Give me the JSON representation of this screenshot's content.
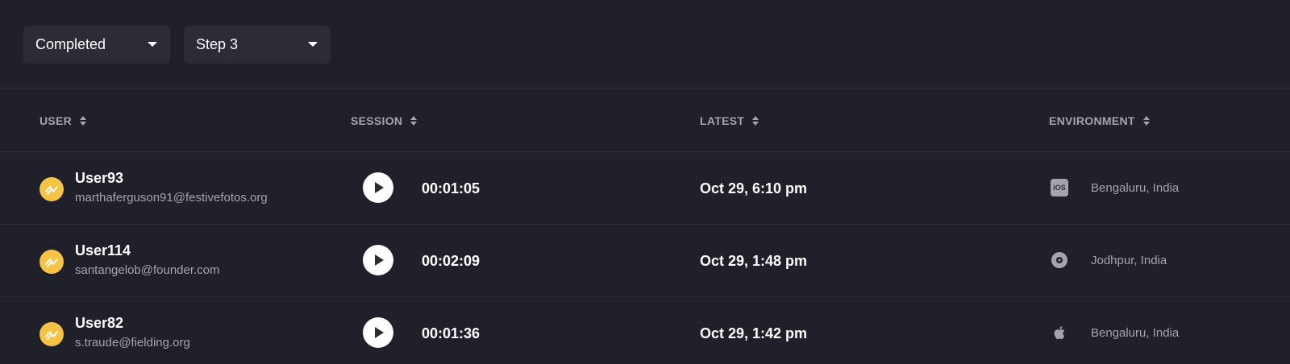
{
  "filters": {
    "status": {
      "selected": "Completed"
    },
    "step": {
      "selected": "Step 3"
    }
  },
  "table": {
    "columns": [
      {
        "label": "USER"
      },
      {
        "label": "SESSION"
      },
      {
        "label": "LATEST"
      },
      {
        "label": "ENVIRONMENT"
      }
    ],
    "rows": [
      {
        "user_name": "User93",
        "email": "marthaferguson91@festivefotos.org",
        "duration": "00:01:05",
        "latest": "Oct 29, 6:10 pm",
        "env_icon": "ios-icon",
        "env_icon_text": "iOS",
        "location": "Bengaluru, India"
      },
      {
        "user_name": "User114",
        "email": "santangelob@founder.com",
        "duration": "00:02:09",
        "latest": "Oct 29, 1:48 pm",
        "env_icon": "disc-icon",
        "location": "Jodhpur, India"
      },
      {
        "user_name": "User82",
        "email": "s.traude@fielding.org",
        "duration": "00:01:36",
        "latest": "Oct 29, 1:42 pm",
        "env_icon": "apple-icon",
        "location": "Bengaluru, India"
      }
    ]
  },
  "colors": {
    "background": "#1f2029",
    "dropdown_bg": "#2b2c36",
    "avatar": "#f6c344",
    "muted_text": "#a3a4ae"
  }
}
